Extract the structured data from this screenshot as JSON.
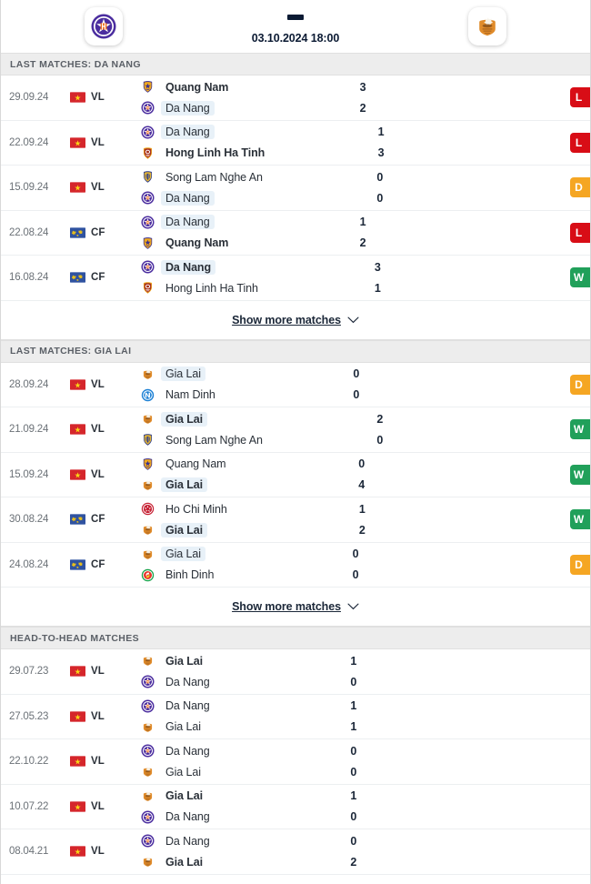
{
  "header": {
    "home_team": "Da Nang",
    "away_team": "Gia Lai",
    "home_logo_icon": "da-nang-crest-icon",
    "away_logo_icon": "gia-lai-crest-icon",
    "score_placeholder": "-",
    "datetime": "03.10.2024 18:00"
  },
  "sections": [
    {
      "id": "last-matches-da-nang",
      "title": "LAST MATCHES: DA NANG",
      "show_more": "Show more matches",
      "matches": [
        {
          "date": "29.09.24",
          "competition": "VL",
          "flag": "vietnam",
          "home": {
            "name": "Quang Nam",
            "crest": "quang-nam",
            "bold": true,
            "highlight": false
          },
          "away": {
            "name": "Da Nang",
            "crest": "da-nang",
            "bold": false,
            "highlight": true
          },
          "home_score": "3",
          "away_score": "2",
          "result": "L"
        },
        {
          "date": "22.09.24",
          "competition": "VL",
          "flag": "vietnam",
          "home": {
            "name": "Da Nang",
            "crest": "da-nang",
            "bold": false,
            "highlight": true
          },
          "away": {
            "name": "Hong Linh Ha Tinh",
            "crest": "hong-linh-ha-tinh",
            "bold": true,
            "highlight": false
          },
          "home_score": "1",
          "away_score": "3",
          "result": "L"
        },
        {
          "date": "15.09.24",
          "competition": "VL",
          "flag": "vietnam",
          "home": {
            "name": "Song Lam Nghe An",
            "crest": "song-lam-nghe-an",
            "bold": false,
            "highlight": false
          },
          "away": {
            "name": "Da Nang",
            "crest": "da-nang",
            "bold": false,
            "highlight": true
          },
          "home_score": "0",
          "away_score": "0",
          "result": "D"
        },
        {
          "date": "22.08.24",
          "competition": "CF",
          "flag": "world",
          "home": {
            "name": "Da Nang",
            "crest": "da-nang",
            "bold": false,
            "highlight": true
          },
          "away": {
            "name": "Quang Nam",
            "crest": "quang-nam",
            "bold": true,
            "highlight": false
          },
          "home_score": "1",
          "away_score": "2",
          "result": "L"
        },
        {
          "date": "16.08.24",
          "competition": "CF",
          "flag": "world",
          "home": {
            "name": "Da Nang",
            "crest": "da-nang",
            "bold": true,
            "highlight": true
          },
          "away": {
            "name": "Hong Linh Ha Tinh",
            "crest": "hong-linh-ha-tinh",
            "bold": false,
            "highlight": false
          },
          "home_score": "3",
          "away_score": "1",
          "result": "W"
        }
      ]
    },
    {
      "id": "last-matches-gia-lai",
      "title": "LAST MATCHES: GIA LAI",
      "show_more": "Show more matches",
      "matches": [
        {
          "date": "28.09.24",
          "competition": "VL",
          "flag": "vietnam",
          "home": {
            "name": "Gia Lai",
            "crest": "gia-lai",
            "bold": false,
            "highlight": true
          },
          "away": {
            "name": "Nam Dinh",
            "crest": "nam-dinh",
            "bold": false,
            "highlight": false
          },
          "home_score": "0",
          "away_score": "0",
          "result": "D"
        },
        {
          "date": "21.09.24",
          "competition": "VL",
          "flag": "vietnam",
          "home": {
            "name": "Gia Lai",
            "crest": "gia-lai",
            "bold": true,
            "highlight": true
          },
          "away": {
            "name": "Song Lam Nghe An",
            "crest": "song-lam-nghe-an",
            "bold": false,
            "highlight": false
          },
          "home_score": "2",
          "away_score": "0",
          "result": "W"
        },
        {
          "date": "15.09.24",
          "competition": "VL",
          "flag": "vietnam",
          "home": {
            "name": "Quang Nam",
            "crest": "quang-nam",
            "bold": false,
            "highlight": false
          },
          "away": {
            "name": "Gia Lai",
            "crest": "gia-lai",
            "bold": true,
            "highlight": true
          },
          "home_score": "0",
          "away_score": "4",
          "result": "W"
        },
        {
          "date": "30.08.24",
          "competition": "CF",
          "flag": "world",
          "home": {
            "name": "Ho Chi Minh",
            "crest": "ho-chi-minh",
            "bold": false,
            "highlight": false
          },
          "away": {
            "name": "Gia Lai",
            "crest": "gia-lai",
            "bold": true,
            "highlight": true
          },
          "home_score": "1",
          "away_score": "2",
          "result": "W"
        },
        {
          "date": "24.08.24",
          "competition": "CF",
          "flag": "world",
          "home": {
            "name": "Gia Lai",
            "crest": "gia-lai",
            "bold": false,
            "highlight": true
          },
          "away": {
            "name": "Binh Dinh",
            "crest": "binh-dinh",
            "bold": false,
            "highlight": false
          },
          "home_score": "0",
          "away_score": "0",
          "result": "D"
        }
      ]
    },
    {
      "id": "head-to-head-matches",
      "title": "HEAD-TO-HEAD MATCHES",
      "show_more": null,
      "matches": [
        {
          "date": "29.07.23",
          "competition": "VL",
          "flag": "vietnam",
          "home": {
            "name": "Gia Lai",
            "crest": "gia-lai",
            "bold": true,
            "highlight": false
          },
          "away": {
            "name": "Da Nang",
            "crest": "da-nang",
            "bold": false,
            "highlight": false
          },
          "home_score": "1",
          "away_score": "0",
          "result": null
        },
        {
          "date": "27.05.23",
          "competition": "VL",
          "flag": "vietnam",
          "home": {
            "name": "Da Nang",
            "crest": "da-nang",
            "bold": false,
            "highlight": false
          },
          "away": {
            "name": "Gia Lai",
            "crest": "gia-lai",
            "bold": false,
            "highlight": false
          },
          "home_score": "1",
          "away_score": "1",
          "result": null
        },
        {
          "date": "22.10.22",
          "competition": "VL",
          "flag": "vietnam",
          "home": {
            "name": "Da Nang",
            "crest": "da-nang",
            "bold": false,
            "highlight": false
          },
          "away": {
            "name": "Gia Lai",
            "crest": "gia-lai",
            "bold": false,
            "highlight": false
          },
          "home_score": "0",
          "away_score": "0",
          "result": null
        },
        {
          "date": "10.07.22",
          "competition": "VL",
          "flag": "vietnam",
          "home": {
            "name": "Gia Lai",
            "crest": "gia-lai",
            "bold": true,
            "highlight": false
          },
          "away": {
            "name": "Da Nang",
            "crest": "da-nang",
            "bold": false,
            "highlight": false
          },
          "home_score": "1",
          "away_score": "0",
          "result": null
        },
        {
          "date": "08.04.21",
          "competition": "VL",
          "flag": "vietnam",
          "home": {
            "name": "Da Nang",
            "crest": "da-nang",
            "bold": false,
            "highlight": false
          },
          "away": {
            "name": "Gia Lai",
            "crest": "gia-lai",
            "bold": true,
            "highlight": false
          },
          "home_score": "0",
          "away_score": "2",
          "result": null
        }
      ]
    }
  ],
  "colors": {
    "win": "#21a05a",
    "draw": "#f5a623",
    "loss": "#d80d16",
    "section_bg": "#ededed",
    "highlight": "#e8f1f8"
  }
}
